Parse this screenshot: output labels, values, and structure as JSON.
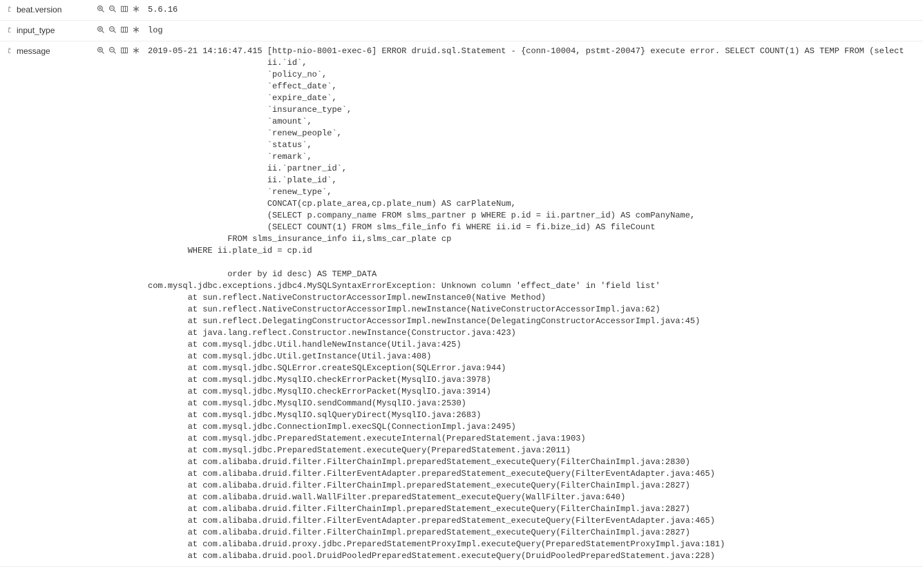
{
  "fields": [
    {
      "type": "t",
      "name": "beat.version",
      "value": "5.6.16"
    },
    {
      "type": "t",
      "name": "input_type",
      "value": "log"
    },
    {
      "type": "t",
      "name": "message",
      "value": "2019-05-21 14:16:47.415 [http-nio-8001-exec-6] ERROR druid.sql.Statement - {conn-10004, pstmt-20047} execute error. SELECT COUNT(1) AS TEMP FROM (select \n                        ii.`id`,\n                        `policy_no`,\n                        `effect_date`,\n                        `expire_date`,\n                        `insurance_type`,\n                        `amount`,\n                        `renew_people`,\n                        `status`,\n                        `remark`,\n                        ii.`partner_id`,\n                        ii.`plate_id`,\n                        `renew_type`,\n                        CONCAT(cp.plate_area,cp.plate_num) AS carPlateNum,\n                        (SELECT p.company_name FROM slms_partner p WHERE p.id = ii.partner_id) AS comPanyName,\n                        (SELECT COUNT(1) FROM slms_file_info fi WHERE ii.id = fi.bize_id) AS fileCount\n                FROM slms_insurance_info ii,slms_car_plate cp\n        WHERE ii.plate_id = cp.id\n         \n                order by id desc) AS TEMP_DATA\ncom.mysql.jdbc.exceptions.jdbc4.MySQLSyntaxErrorException: Unknown column 'effect_date' in 'field list'\n        at sun.reflect.NativeConstructorAccessorImpl.newInstance0(Native Method)\n        at sun.reflect.NativeConstructorAccessorImpl.newInstance(NativeConstructorAccessorImpl.java:62)\n        at sun.reflect.DelegatingConstructorAccessorImpl.newInstance(DelegatingConstructorAccessorImpl.java:45)\n        at java.lang.reflect.Constructor.newInstance(Constructor.java:423)\n        at com.mysql.jdbc.Util.handleNewInstance(Util.java:425)\n        at com.mysql.jdbc.Util.getInstance(Util.java:408)\n        at com.mysql.jdbc.SQLError.createSQLException(SQLError.java:944)\n        at com.mysql.jdbc.MysqlIO.checkErrorPacket(MysqlIO.java:3978)\n        at com.mysql.jdbc.MysqlIO.checkErrorPacket(MysqlIO.java:3914)\n        at com.mysql.jdbc.MysqlIO.sendCommand(MysqlIO.java:2530)\n        at com.mysql.jdbc.MysqlIO.sqlQueryDirect(MysqlIO.java:2683)\n        at com.mysql.jdbc.ConnectionImpl.execSQL(ConnectionImpl.java:2495)\n        at com.mysql.jdbc.PreparedStatement.executeInternal(PreparedStatement.java:1903)\n        at com.mysql.jdbc.PreparedStatement.executeQuery(PreparedStatement.java:2011)\n        at com.alibaba.druid.filter.FilterChainImpl.preparedStatement_executeQuery(FilterChainImpl.java:2830)\n        at com.alibaba.druid.filter.FilterEventAdapter.preparedStatement_executeQuery(FilterEventAdapter.java:465)\n        at com.alibaba.druid.filter.FilterChainImpl.preparedStatement_executeQuery(FilterChainImpl.java:2827)\n        at com.alibaba.druid.wall.WallFilter.preparedStatement_executeQuery(WallFilter.java:640)\n        at com.alibaba.druid.filter.FilterChainImpl.preparedStatement_executeQuery(FilterChainImpl.java:2827)\n        at com.alibaba.druid.filter.FilterEventAdapter.preparedStatement_executeQuery(FilterEventAdapter.java:465)\n        at com.alibaba.druid.filter.FilterChainImpl.preparedStatement_executeQuery(FilterChainImpl.java:2827)\n        at com.alibaba.druid.proxy.jdbc.PreparedStatementProxyImpl.executeQuery(PreparedStatementProxyImpl.java:181)\n        at com.alibaba.druid.pool.DruidPooledPreparedStatement.executeQuery(DruidPooledPreparedStatement.java:228)"
    }
  ]
}
